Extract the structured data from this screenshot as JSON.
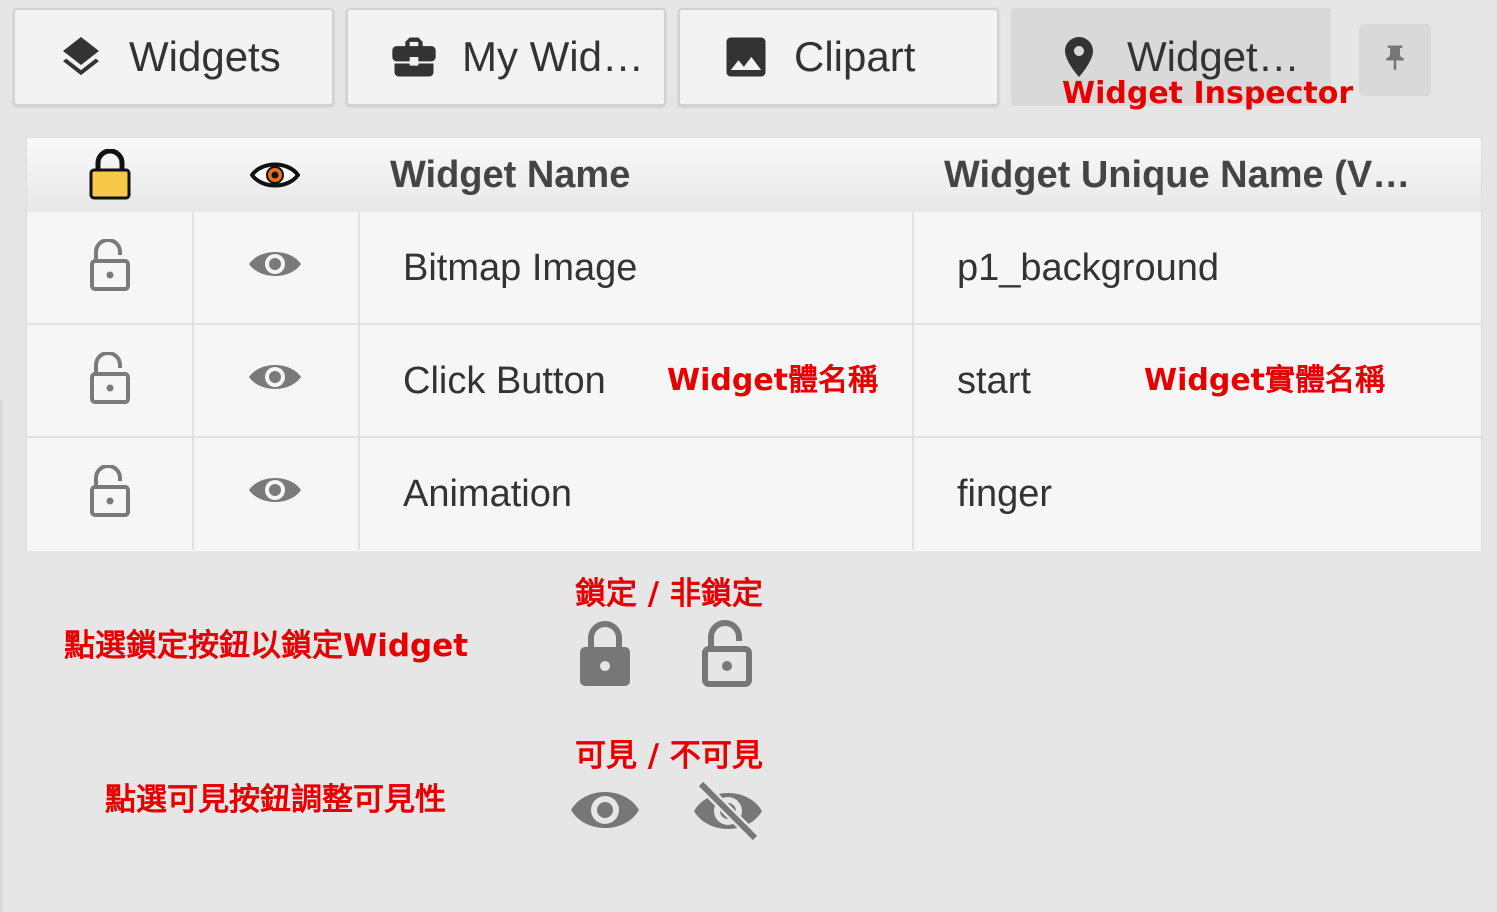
{
  "tabs": [
    {
      "label": "Widgets",
      "icon": "layers-icon"
    },
    {
      "label": "My Wid…",
      "icon": "briefcase-icon"
    },
    {
      "label": "Clipart",
      "icon": "image-icon"
    },
    {
      "label": "Widget…",
      "icon": "location-pin-icon",
      "active": true
    }
  ],
  "pin_icon": "pushpin-icon",
  "annotations": {
    "inspector": "Widget Inspector",
    "widget_name": "Widget體名稱",
    "widget_unique": "Widget實體名稱",
    "lock_title": "鎖定 / 非鎖定",
    "lock_desc": "點選鎖定按鈕以鎖定Widget",
    "visible_title": "可見 / 不可見",
    "visible_desc": "點選可見按鈕調整可見性"
  },
  "table": {
    "headers": [
      "",
      "",
      "Widget Name",
      "Widget Unique Name (V…"
    ],
    "rows": [
      {
        "name": "Bitmap Image",
        "unique": "p1_background",
        "locked": false,
        "visible": true
      },
      {
        "name": "Click Button",
        "unique": "start",
        "locked": false,
        "visible": true
      },
      {
        "name": "Animation",
        "unique": "finger",
        "locked": false,
        "visible": true
      }
    ]
  },
  "colors": {
    "accent_red": "#e60000",
    "lock_yellow": "#f7c948",
    "eye_orange": "#e8701a",
    "icon_gray": "#777777"
  }
}
